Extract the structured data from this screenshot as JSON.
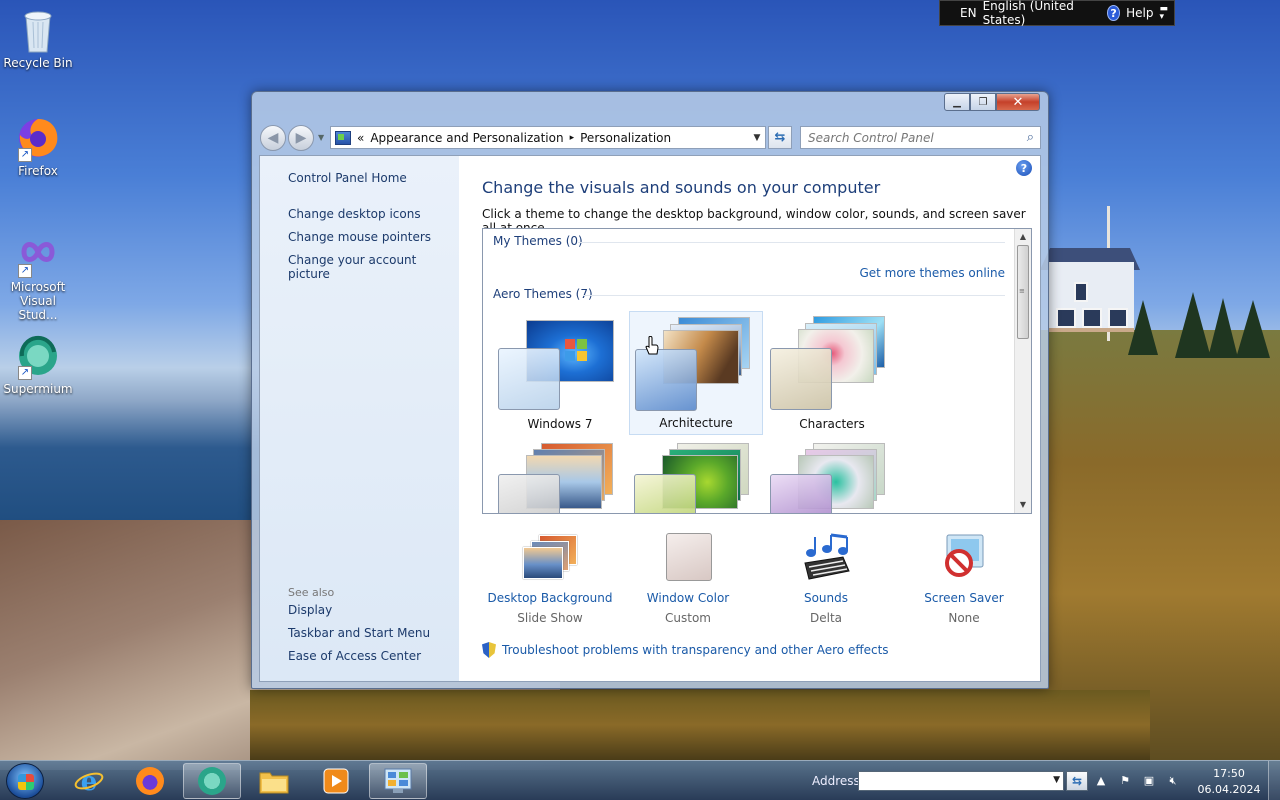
{
  "desktop": {
    "icons": [
      {
        "label": "Recycle Bin"
      },
      {
        "label": "Firefox"
      },
      {
        "label": "Microsoft Visual Stud..."
      },
      {
        "label": "Supermium"
      }
    ]
  },
  "langbar": {
    "lang_code": "EN",
    "lang_name": "English (United States)",
    "help": "Help"
  },
  "window": {
    "address": {
      "overflow": "«",
      "crumbs": [
        "Appearance and Personalization",
        "Personalization"
      ],
      "separator": "▸"
    },
    "search": {
      "placeholder": "Search Control Panel"
    },
    "left": {
      "home": "Control Panel Home",
      "tasks": [
        "Change desktop icons",
        "Change mouse pointers",
        "Change your account picture"
      ],
      "see_also_label": "See also",
      "see_also": [
        "Display",
        "Taskbar and Start Menu",
        "Ease of Access Center"
      ]
    },
    "main": {
      "title": "Change the visuals and sounds on your computer",
      "description": "Click a theme to change the desktop background, window color, sounds, and screen saver all at once.",
      "my_themes": "My Themes (0)",
      "more_themes": "Get more themes online",
      "aero_themes": "Aero Themes (7)",
      "themes": [
        {
          "name": "Windows 7",
          "selected": false
        },
        {
          "name": "Architecture",
          "selected": true
        },
        {
          "name": "Characters",
          "selected": false
        }
      ],
      "settings": [
        {
          "title": "Desktop Background",
          "value": "Slide Show",
          "icon": "photo-stack-icon"
        },
        {
          "title": "Window Color",
          "value": "Custom",
          "icon": "color-swatch-icon"
        },
        {
          "title": "Sounds",
          "value": "Delta",
          "icon": "music-notes-icon"
        },
        {
          "title": "Screen Saver",
          "value": "None",
          "icon": "screen-saver-icon"
        }
      ],
      "troubleshoot": "Troubleshoot problems with transparency and other Aero effects"
    }
  },
  "taskbar": {
    "address_label": "Address",
    "address_value": "",
    "time": "17:50",
    "date": "06.04.2024"
  }
}
